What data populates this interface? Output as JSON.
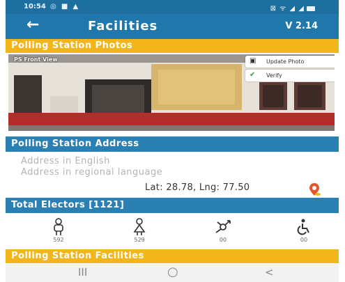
{
  "status_bar": {
    "time": "10:54",
    "left_icons": "◎ ■ ▲",
    "right_icons": "⊠ ᯤ ◢ ◢"
  },
  "app_bar": {
    "back_icon": "arrow-left-icon",
    "title": "Facilities",
    "version": "V 2.14"
  },
  "photos_section": {
    "header": "Polling Station Photos",
    "photo_label": "PS Front View",
    "update_button": "Update Photo",
    "verify_button": "Verify"
  },
  "address_section": {
    "header": "Polling Station Address",
    "address_english": "Address in English",
    "address_regional": "Address in regional language",
    "latlng": "Lat: 28.78, Lng: 77.50",
    "pin_icon": "location-pin-icon"
  },
  "electors_section": {
    "header": "Total Electors [1121]",
    "items": [
      {
        "icon": "male-voter-icon",
        "count": "592"
      },
      {
        "icon": "female-voter-icon",
        "count": "529"
      },
      {
        "icon": "third-gender-icon",
        "count": "00"
      },
      {
        "icon": "wheelchair-icon",
        "count": "00"
      }
    ]
  },
  "facilities_section": {
    "header": "Polling Station Facilities"
  },
  "nav_bar": {
    "recents": "III",
    "home": "○",
    "back": "<"
  },
  "colors": {
    "primary": "#1f77ab",
    "accent": "#f3b51c",
    "pin": "#e4572e"
  }
}
